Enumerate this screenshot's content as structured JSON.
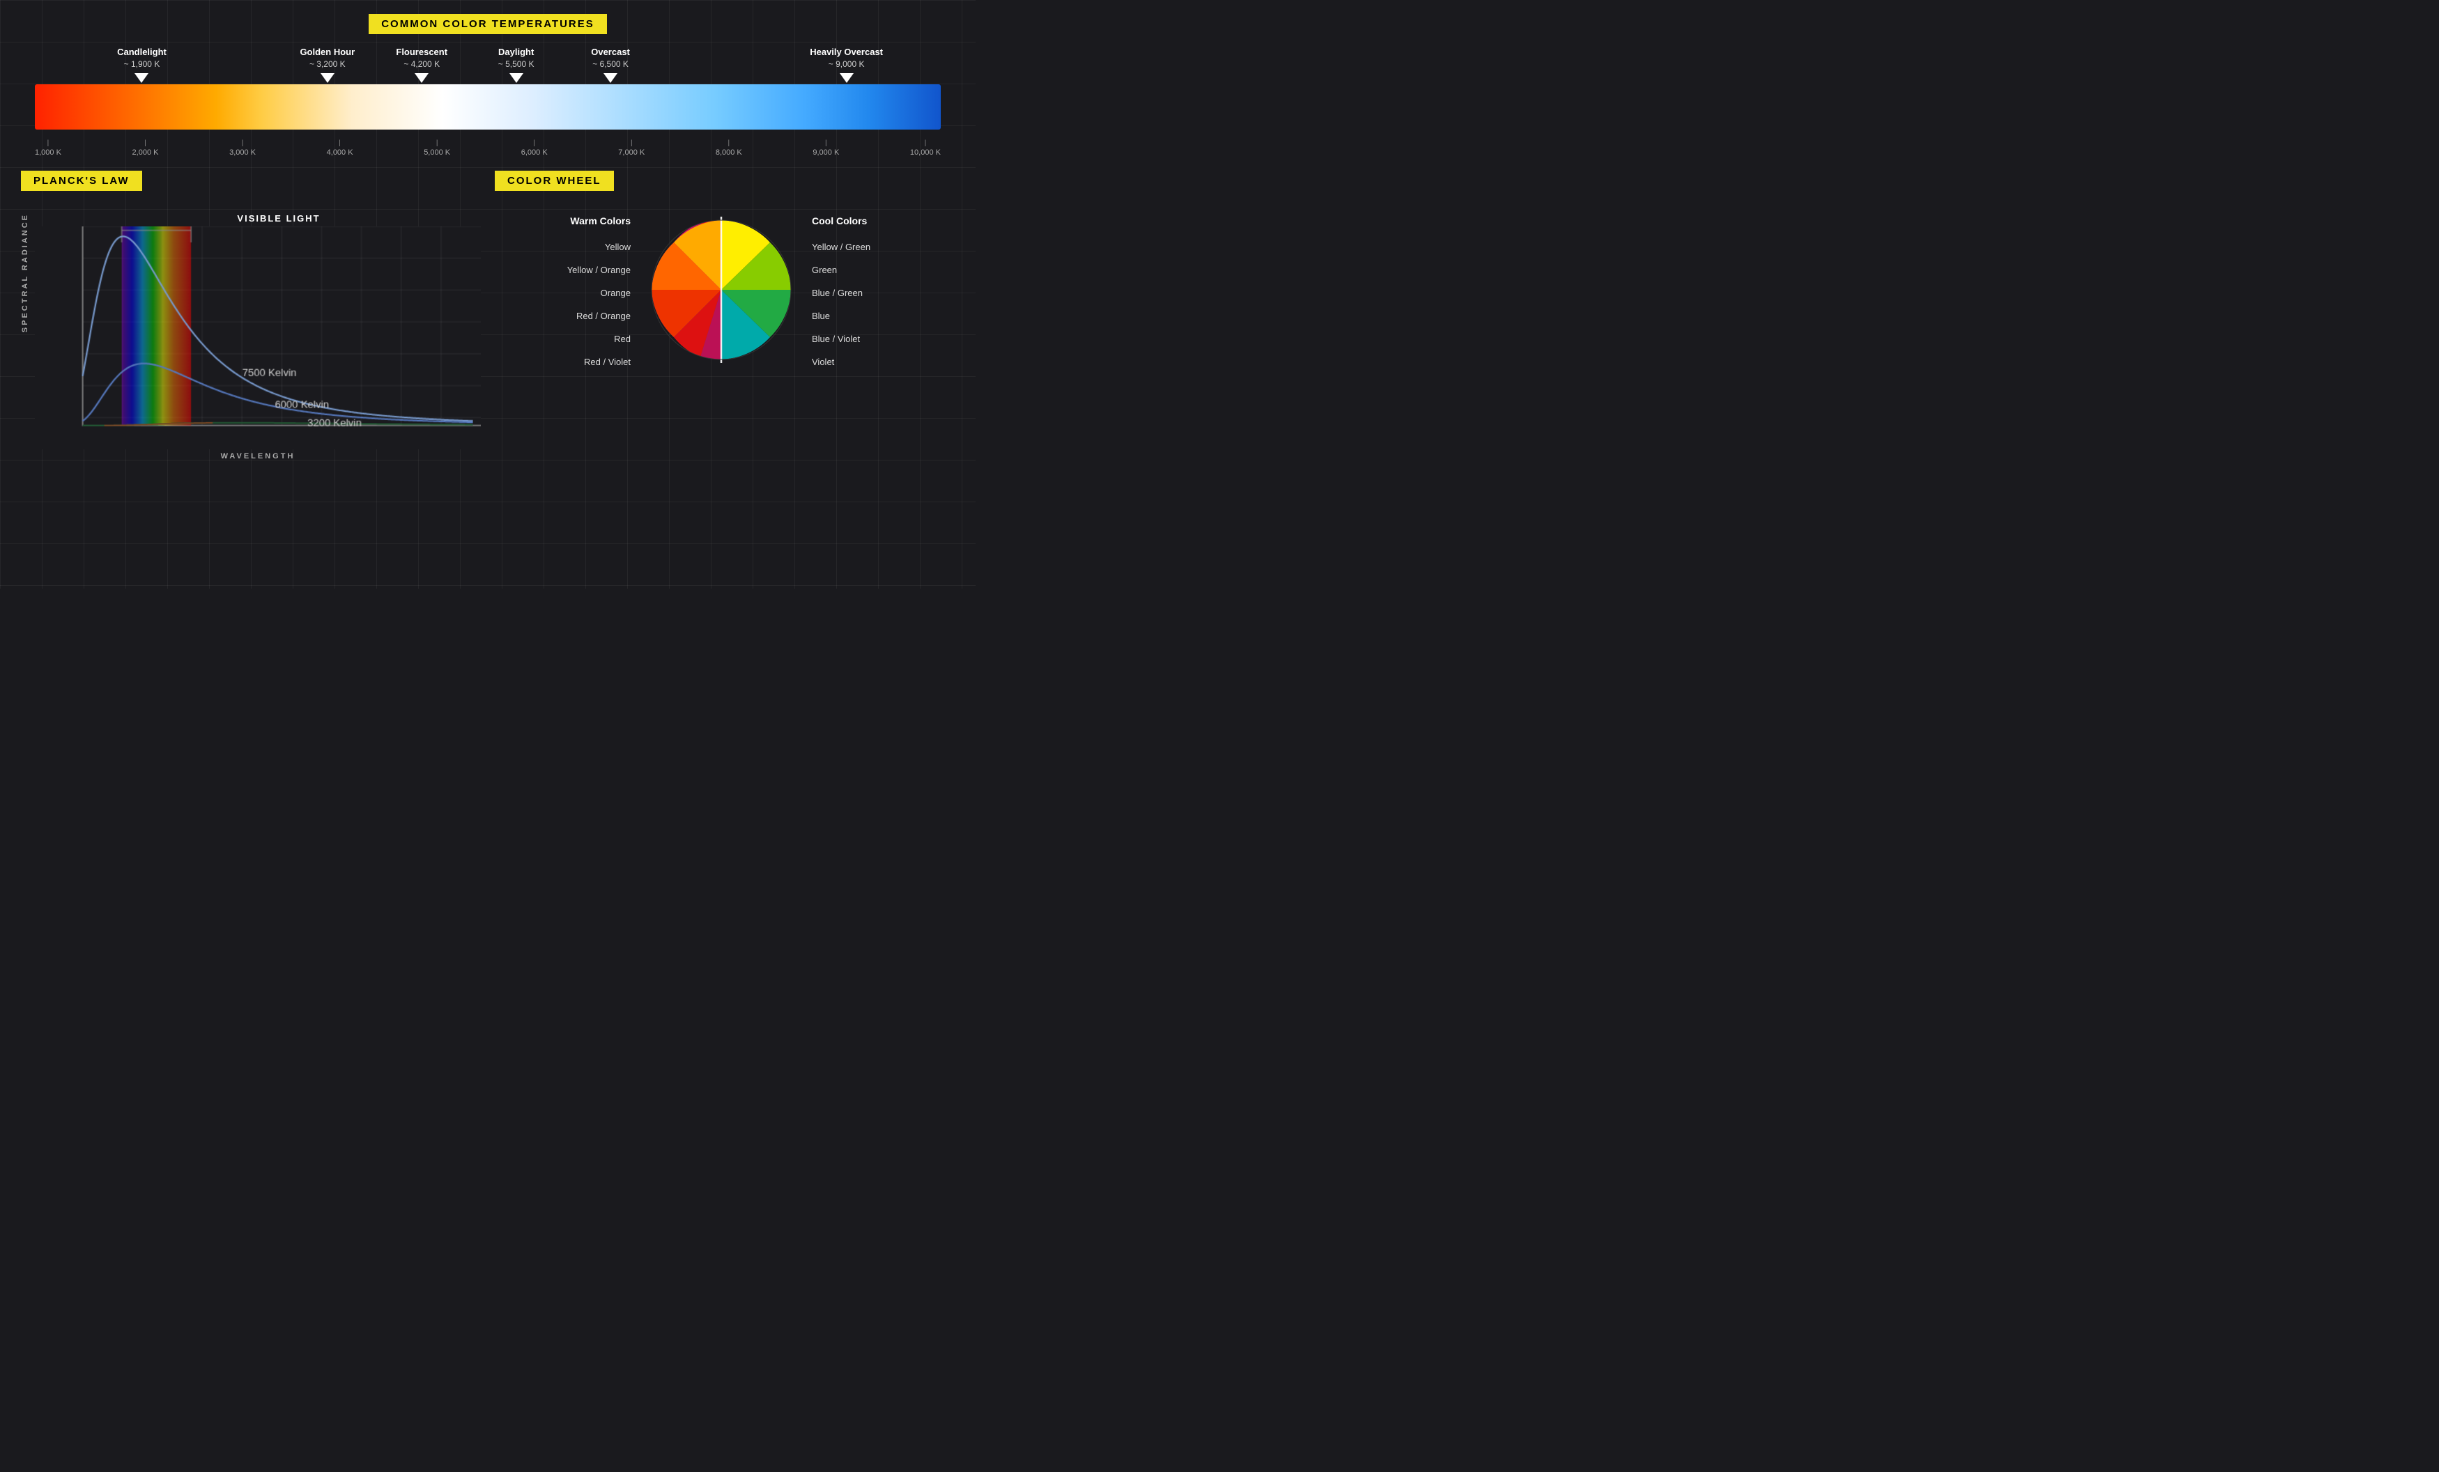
{
  "title": "Common Color Temperatures",
  "title_badge": "COMMON COLOR TEMPERATURES",
  "temperature_markers": [
    {
      "label": "Candlelight",
      "kelvin": "~ 1,900 K",
      "position": 0.09
    },
    {
      "label": "Golden Hour",
      "kelvin": "~ 3,200 K",
      "position": 0.24
    },
    {
      "label": "Flourescent",
      "kelvin": "~ 4,200 K",
      "position": 0.35
    },
    {
      "label": "Daylight",
      "kelvin": "~ 5,500 K",
      "position": 0.5
    },
    {
      "label": "Overcast",
      "kelvin": "~ 6,500 K",
      "position": 0.61
    },
    {
      "label": "Heavily Overcast",
      "kelvin": "~ 9,000 K",
      "position": 0.89
    }
  ],
  "scale_labels": [
    "1,000 K",
    "2,000 K",
    "3,000 K",
    "4,000 K",
    "5,000 K",
    "6,000 K",
    "7,000 K",
    "8,000 K",
    "9,000 K",
    "10,000 K"
  ],
  "planck": {
    "badge": "PLANCK'S LAW",
    "y_axis": "SPECTRAL RADIANCE",
    "x_axis": "WAVELENGTH",
    "visible_light_label": "VISIBLE LIGHT",
    "curves": [
      {
        "label": "7500 Kelvin",
        "color": "#4488cc"
      },
      {
        "label": "6000 Kelvin",
        "color": "#2255aa"
      },
      {
        "label": "3200 Kelvin",
        "color": "#116633"
      }
    ]
  },
  "color_wheel": {
    "badge": "COLOR WHEEL",
    "warm_title": "Warm Colors",
    "cool_title": "Cool Colors",
    "warm_labels": [
      "Yellow",
      "Yellow / Orange",
      "Orange",
      "Red / Orange",
      "Red",
      "Red / Violet"
    ],
    "cool_labels": [
      "Yellow / Green",
      "Green",
      "Blue / Green",
      "Blue",
      "Blue / Violet",
      "Violet"
    ]
  }
}
